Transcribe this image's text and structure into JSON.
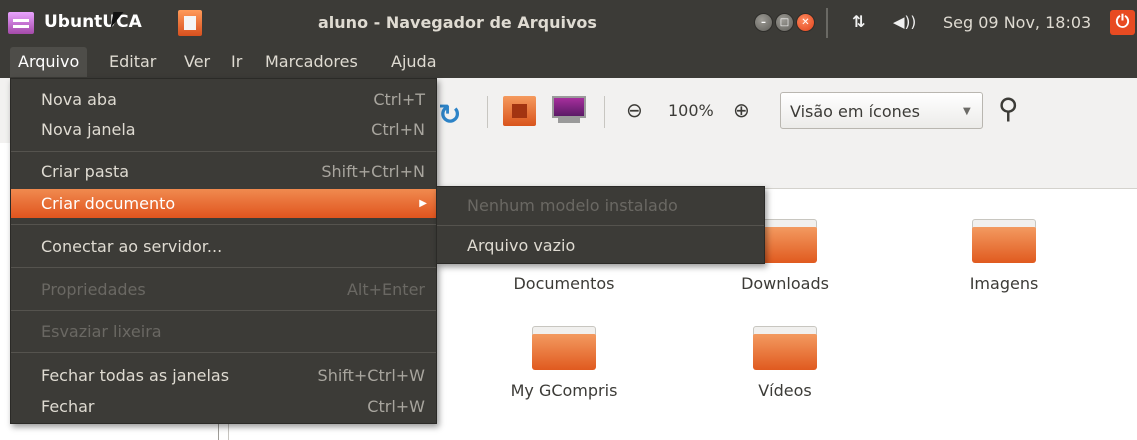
{
  "panel": {
    "app_name": "UbuntUCA",
    "window_title": "aluno - Navegador de Arquivos",
    "clock": "Seg 09 Nov, 18:03",
    "network_icon": "network-updown-icon",
    "sound_icon": "volume-icon",
    "power_icon": "power-icon"
  },
  "menubar": {
    "items": [
      "Arquivo",
      "Editar",
      "Ver",
      "Ir",
      "Marcadores",
      "Ajuda"
    ]
  },
  "arquivo_menu": {
    "items": [
      {
        "label": "Nova aba",
        "shortcut": "Ctrl+T",
        "enabled": true
      },
      {
        "label": "Nova janela",
        "shortcut": "Ctrl+N",
        "enabled": true
      },
      {
        "label": "Criar pasta",
        "shortcut": "Shift+Ctrl+N",
        "enabled": true
      },
      {
        "label": "Criar documento",
        "shortcut": "",
        "enabled": true,
        "highlighted": true
      },
      {
        "label": "Conectar ao servidor...",
        "shortcut": "",
        "enabled": true
      },
      {
        "label": "Propriedades",
        "shortcut": "Alt+Enter",
        "enabled": false
      },
      {
        "label": "Esvaziar lixeira",
        "shortcut": "",
        "enabled": false
      },
      {
        "label": "Fechar todas as janelas",
        "shortcut": "Shift+Ctrl+W",
        "enabled": true
      },
      {
        "label": "Fechar",
        "shortcut": "Ctrl+W",
        "enabled": true
      }
    ]
  },
  "submenu": {
    "items": [
      {
        "label": "Nenhum modelo instalado",
        "enabled": false
      },
      {
        "label": "Arquivo vazio",
        "enabled": true
      }
    ]
  },
  "toolbar": {
    "zoom_level": "100%",
    "view_mode": "Visão em ícones"
  },
  "folders": [
    "Documentos",
    "Downloads",
    "Imagens",
    "My GCompris",
    "Vídeos"
  ],
  "colors": {
    "panel_bg": "#3c3b37",
    "accent": "#e0541e",
    "folder": "#f39a60"
  }
}
